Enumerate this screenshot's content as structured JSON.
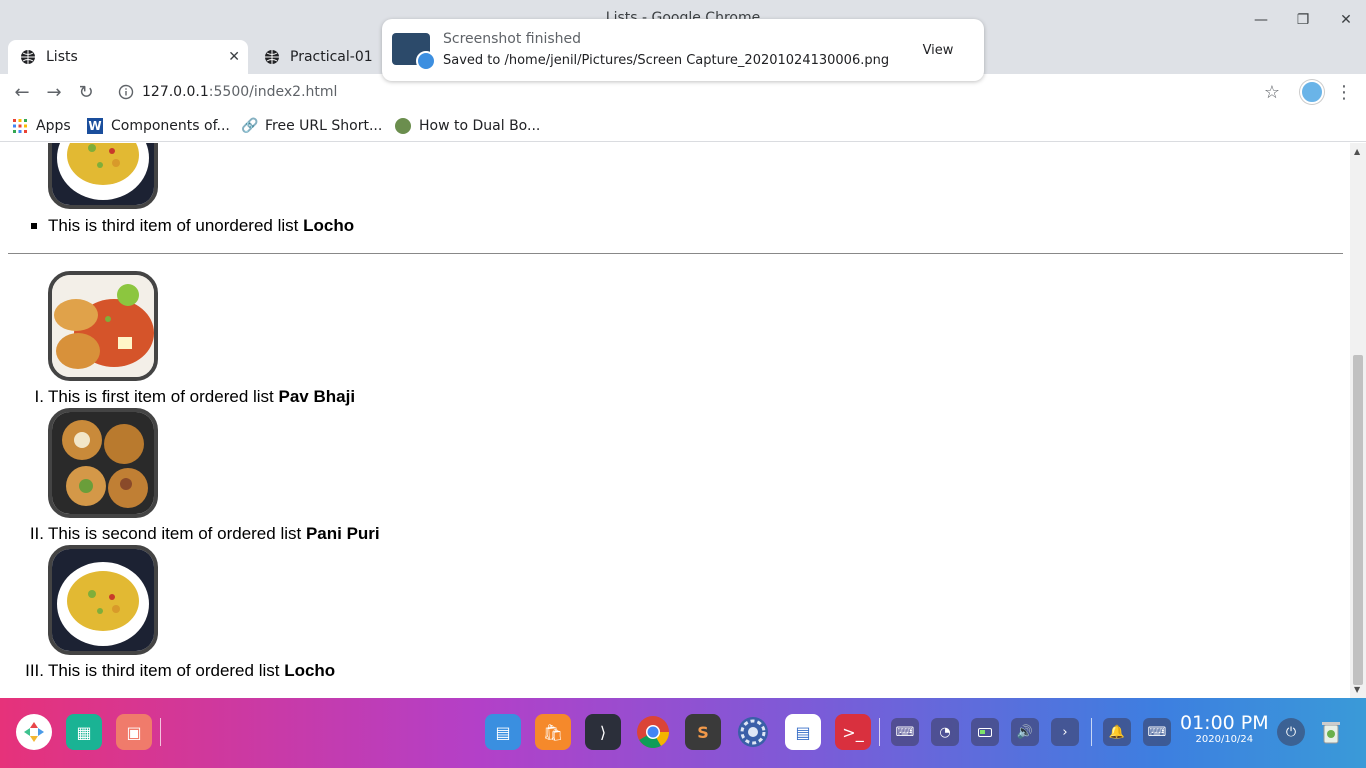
{
  "window": {
    "title": "Lists - Google Chrome"
  },
  "tabs": [
    {
      "label": "Lists",
      "active": true
    },
    {
      "label": "Practical-01",
      "active": false
    }
  ],
  "toolbar": {
    "url_host": "127.0.0.1",
    "url_path": ":5500/index2.html"
  },
  "bookmarks": [
    {
      "label": "Apps",
      "icon": "apps-grid-icon"
    },
    {
      "label": "Components of...",
      "icon": "word-w-icon"
    },
    {
      "label": "Free URL Short...",
      "icon": "link-icon"
    },
    {
      "label": "How to Dual Bo...",
      "icon": "site-favicon-icon"
    }
  ],
  "notification": {
    "title": "Screenshot finished",
    "message": "Saved to /home/jenil/Pictures/Screen Capture_20201024130006.png",
    "action": "View"
  },
  "content": {
    "unordered_item": {
      "text": "This is third item of unordered list ",
      "bold": "Locho"
    },
    "ordered_items": [
      {
        "marker": "I.",
        "text": "This is first item of ordered list ",
        "bold": "Pav Bhaji"
      },
      {
        "marker": "II.",
        "text": "This is second item of ordered list ",
        "bold": "Pani Puri"
      },
      {
        "marker": "III.",
        "text": "This is third item of ordered list ",
        "bold": "Locho"
      }
    ]
  },
  "taskbar": {
    "time": "01:00 PM",
    "date": "2020/10/24"
  },
  "colors": {
    "chrome_frame": "#dee1e6",
    "taskbar_start": "#e6327a",
    "taskbar_end": "#3a9ad8"
  }
}
